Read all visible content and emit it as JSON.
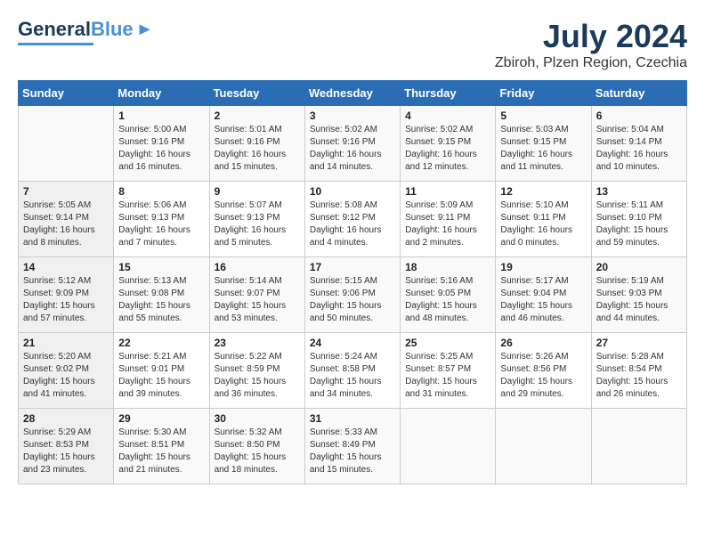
{
  "header": {
    "logo_general": "General",
    "logo_blue": "Blue",
    "title": "July 2024",
    "location": "Zbiroh, Plzen Region, Czechia"
  },
  "days_of_week": [
    "Sunday",
    "Monday",
    "Tuesday",
    "Wednesday",
    "Thursday",
    "Friday",
    "Saturday"
  ],
  "weeks": [
    [
      {
        "day": "",
        "info": ""
      },
      {
        "day": "1",
        "info": "Sunrise: 5:00 AM\nSunset: 9:16 PM\nDaylight: 16 hours\nand 16 minutes."
      },
      {
        "day": "2",
        "info": "Sunrise: 5:01 AM\nSunset: 9:16 PM\nDaylight: 16 hours\nand 15 minutes."
      },
      {
        "day": "3",
        "info": "Sunrise: 5:02 AM\nSunset: 9:16 PM\nDaylight: 16 hours\nand 14 minutes."
      },
      {
        "day": "4",
        "info": "Sunrise: 5:02 AM\nSunset: 9:15 PM\nDaylight: 16 hours\nand 12 minutes."
      },
      {
        "day": "5",
        "info": "Sunrise: 5:03 AM\nSunset: 9:15 PM\nDaylight: 16 hours\nand 11 minutes."
      },
      {
        "day": "6",
        "info": "Sunrise: 5:04 AM\nSunset: 9:14 PM\nDaylight: 16 hours\nand 10 minutes."
      }
    ],
    [
      {
        "day": "7",
        "info": "Sunrise: 5:05 AM\nSunset: 9:14 PM\nDaylight: 16 hours\nand 8 minutes."
      },
      {
        "day": "8",
        "info": "Sunrise: 5:06 AM\nSunset: 9:13 PM\nDaylight: 16 hours\nand 7 minutes."
      },
      {
        "day": "9",
        "info": "Sunrise: 5:07 AM\nSunset: 9:13 PM\nDaylight: 16 hours\nand 5 minutes."
      },
      {
        "day": "10",
        "info": "Sunrise: 5:08 AM\nSunset: 9:12 PM\nDaylight: 16 hours\nand 4 minutes."
      },
      {
        "day": "11",
        "info": "Sunrise: 5:09 AM\nSunset: 9:11 PM\nDaylight: 16 hours\nand 2 minutes."
      },
      {
        "day": "12",
        "info": "Sunrise: 5:10 AM\nSunset: 9:11 PM\nDaylight: 16 hours\nand 0 minutes."
      },
      {
        "day": "13",
        "info": "Sunrise: 5:11 AM\nSunset: 9:10 PM\nDaylight: 15 hours\nand 59 minutes."
      }
    ],
    [
      {
        "day": "14",
        "info": "Sunrise: 5:12 AM\nSunset: 9:09 PM\nDaylight: 15 hours\nand 57 minutes."
      },
      {
        "day": "15",
        "info": "Sunrise: 5:13 AM\nSunset: 9:08 PM\nDaylight: 15 hours\nand 55 minutes."
      },
      {
        "day": "16",
        "info": "Sunrise: 5:14 AM\nSunset: 9:07 PM\nDaylight: 15 hours\nand 53 minutes."
      },
      {
        "day": "17",
        "info": "Sunrise: 5:15 AM\nSunset: 9:06 PM\nDaylight: 15 hours\nand 50 minutes."
      },
      {
        "day": "18",
        "info": "Sunrise: 5:16 AM\nSunset: 9:05 PM\nDaylight: 15 hours\nand 48 minutes."
      },
      {
        "day": "19",
        "info": "Sunrise: 5:17 AM\nSunset: 9:04 PM\nDaylight: 15 hours\nand 46 minutes."
      },
      {
        "day": "20",
        "info": "Sunrise: 5:19 AM\nSunset: 9:03 PM\nDaylight: 15 hours\nand 44 minutes."
      }
    ],
    [
      {
        "day": "21",
        "info": "Sunrise: 5:20 AM\nSunset: 9:02 PM\nDaylight: 15 hours\nand 41 minutes."
      },
      {
        "day": "22",
        "info": "Sunrise: 5:21 AM\nSunset: 9:01 PM\nDaylight: 15 hours\nand 39 minutes."
      },
      {
        "day": "23",
        "info": "Sunrise: 5:22 AM\nSunset: 8:59 PM\nDaylight: 15 hours\nand 36 minutes."
      },
      {
        "day": "24",
        "info": "Sunrise: 5:24 AM\nSunset: 8:58 PM\nDaylight: 15 hours\nand 34 minutes."
      },
      {
        "day": "25",
        "info": "Sunrise: 5:25 AM\nSunset: 8:57 PM\nDaylight: 15 hours\nand 31 minutes."
      },
      {
        "day": "26",
        "info": "Sunrise: 5:26 AM\nSunset: 8:56 PM\nDaylight: 15 hours\nand 29 minutes."
      },
      {
        "day": "27",
        "info": "Sunrise: 5:28 AM\nSunset: 8:54 PM\nDaylight: 15 hours\nand 26 minutes."
      }
    ],
    [
      {
        "day": "28",
        "info": "Sunrise: 5:29 AM\nSunset: 8:53 PM\nDaylight: 15 hours\nand 23 minutes."
      },
      {
        "day": "29",
        "info": "Sunrise: 5:30 AM\nSunset: 8:51 PM\nDaylight: 15 hours\nand 21 minutes."
      },
      {
        "day": "30",
        "info": "Sunrise: 5:32 AM\nSunset: 8:50 PM\nDaylight: 15 hours\nand 18 minutes."
      },
      {
        "day": "31",
        "info": "Sunrise: 5:33 AM\nSunset: 8:49 PM\nDaylight: 15 hours\nand 15 minutes."
      },
      {
        "day": "",
        "info": ""
      },
      {
        "day": "",
        "info": ""
      },
      {
        "day": "",
        "info": ""
      }
    ]
  ]
}
